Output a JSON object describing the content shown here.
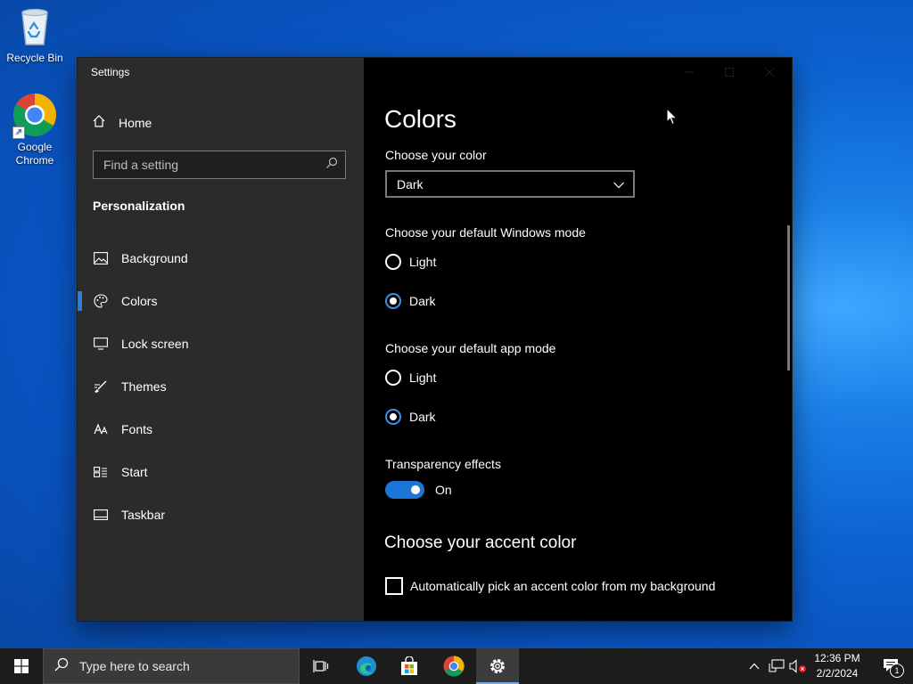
{
  "desktop": {
    "icons": [
      {
        "label": "Recycle Bin"
      },
      {
        "label": "Google Chrome"
      }
    ]
  },
  "window": {
    "title": "Settings",
    "sidebar": {
      "home": "Home",
      "search_placeholder": "Find a setting",
      "section": "Personalization",
      "items": [
        {
          "label": "Background",
          "icon": "image-icon"
        },
        {
          "label": "Colors",
          "icon": "palette-icon",
          "active": true
        },
        {
          "label": "Lock screen",
          "icon": "lock-screen-icon"
        },
        {
          "label": "Themes",
          "icon": "brush-icon"
        },
        {
          "label": "Fonts",
          "icon": "font-icon"
        },
        {
          "label": "Start",
          "icon": "start-icon"
        },
        {
          "label": "Taskbar",
          "icon": "taskbar-icon"
        }
      ]
    },
    "main": {
      "title": "Colors",
      "choose_color_label": "Choose your color",
      "choose_color_value": "Dark",
      "windows_mode_label": "Choose your default Windows mode",
      "windows_mode_options": [
        "Light",
        "Dark"
      ],
      "windows_mode_selected": "Dark",
      "app_mode_label": "Choose your default app mode",
      "app_mode_options": [
        "Light",
        "Dark"
      ],
      "app_mode_selected": "Dark",
      "transparency_label": "Transparency effects",
      "transparency_state": "On",
      "accent_heading": "Choose your accent color",
      "accent_auto_label": "Automatically pick an accent color from my background",
      "accent_auto_checked": false
    }
  },
  "taskbar": {
    "search_placeholder": "Type here to search",
    "time": "12:36 PM",
    "date": "2/2/2024",
    "notification_count": "1"
  },
  "colors": {
    "accent": "#1b75d6",
    "sidebar_bg": "#2b2b2b",
    "content_bg": "#000000",
    "taskbar_bg": "#1c1c1c"
  }
}
